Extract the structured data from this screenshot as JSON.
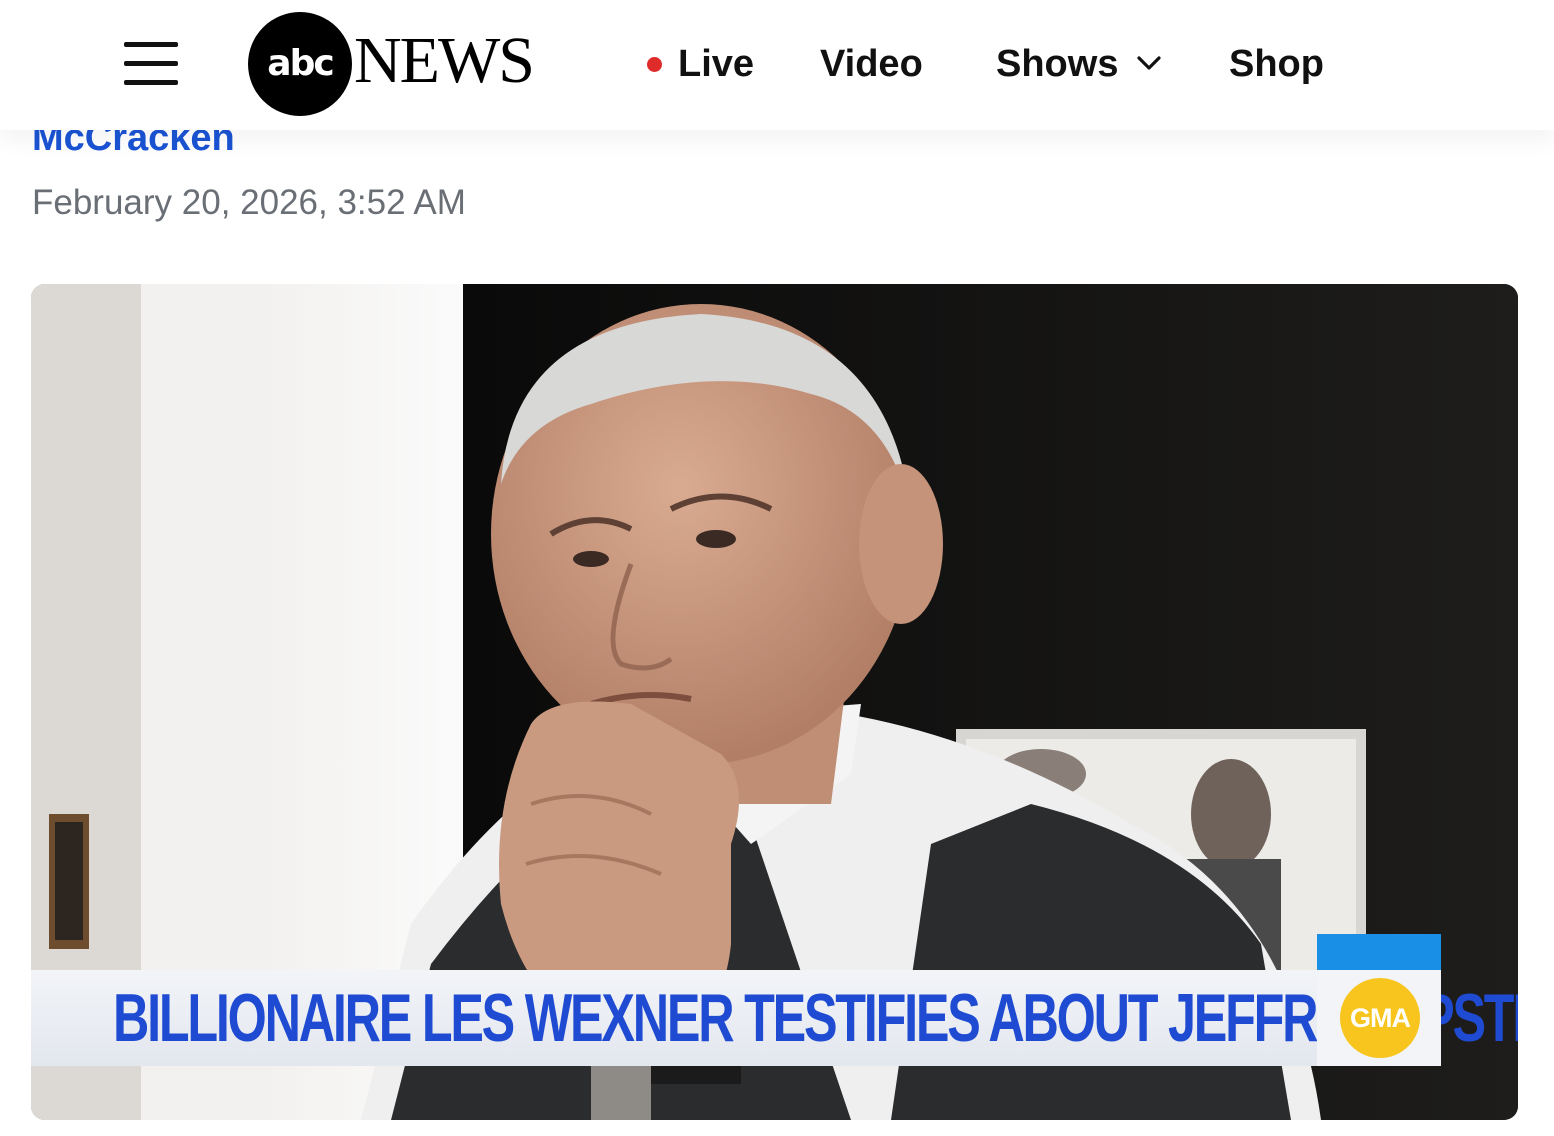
{
  "header": {
    "logo_mark": "abc",
    "logo_word": "NEWS",
    "nav": {
      "live": "Live",
      "video": "Video",
      "shows": "Shows",
      "shop": "Shop"
    },
    "live_dot_color": "#e02b2b"
  },
  "article": {
    "author": "McCracken",
    "date": "February 20, 2026, 3:52 AM"
  },
  "hero": {
    "caption": "BILLIONAIRE LES WEXNER TESTIFIES ABOUT JEFFREY EPSTEIN",
    "badge": "GMA",
    "caption_color": "#1f4bd2",
    "badge_color": "#f7c51d",
    "badge_stripe_color": "#1a8fe6"
  },
  "icons": [
    "menu-icon",
    "chevron-down-icon"
  ]
}
